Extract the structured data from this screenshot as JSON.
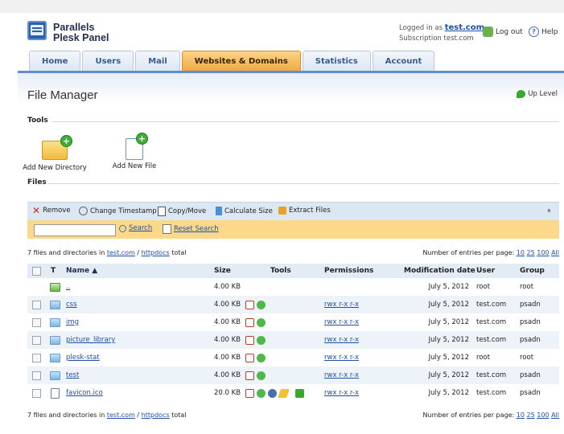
{
  "app": {
    "line1": "Parallels",
    "line2": "Plesk Panel"
  },
  "header": {
    "logged_prefix": "Logged in as",
    "user": "test.com",
    "subscription": "Subscription test.com",
    "logout": "Log out",
    "help": "Help"
  },
  "tabs": [
    "Home",
    "Users",
    "Mail",
    "Websites & Domains",
    "Statistics",
    "Account"
  ],
  "page": {
    "title": "File Manager",
    "up_level": "Up Level"
  },
  "tools": {
    "heading": "Tools",
    "add_directory": "Add New Directory",
    "add_file": "Add New File"
  },
  "files_heading": "Files",
  "toolbar": {
    "remove": "Remove",
    "change_timestamp": "Change Timestamp",
    "copy_move": "Copy/Move",
    "calc_size": "Calculate Size",
    "extract": "Extract Files",
    "collapse": "»"
  },
  "search": {
    "value": "",
    "search": "Search",
    "reset": "Reset Search"
  },
  "summary": {
    "count_text": "7 files and directories in",
    "path1": "test.com",
    "sep": "/",
    "path2": "httpdocs",
    "total": "total",
    "per_page_label": "Number of entries per page:",
    "per_page_options": [
      "10",
      "25",
      "100",
      "All"
    ]
  },
  "columns": {
    "type": "T",
    "name": "Name ▲",
    "size": "Size",
    "tools": "Tools",
    "permissions": "Permissions",
    "modified": "Modification date",
    "user": "User",
    "group": "Group"
  },
  "rows": [
    {
      "icon": "folder-up-icon",
      "name": "..",
      "size": "4.00 KB",
      "perms": "",
      "date": "July 5, 2012",
      "user": "root",
      "group": "root"
    },
    {
      "icon": "folder-icon",
      "name": "css",
      "size": "4.00 KB",
      "perms": "rwx r-x r-x",
      "date": "July 5, 2012",
      "user": "test.com",
      "group": "psadn"
    },
    {
      "icon": "folder-icon",
      "name": "img",
      "size": "4.00 KB",
      "perms": "rwx r-x r-x",
      "date": "July 5, 2012",
      "user": "test.com",
      "group": "psadn"
    },
    {
      "icon": "folder-icon",
      "name": "picture_library",
      "size": "4.00 KB",
      "perms": "rwx r-x r-x",
      "date": "July 5, 2012",
      "user": "test.com",
      "group": "psadn"
    },
    {
      "icon": "folder-icon",
      "name": "plesk-stat",
      "size": "4.00 KB",
      "perms": "rwx r-x r-x",
      "date": "July 5, 2012",
      "user": "root",
      "group": "root"
    },
    {
      "icon": "folder-icon",
      "name": "test",
      "size": "4.00 KB",
      "perms": "rwx r-x r-x",
      "date": "July 5, 2012",
      "user": "test.com",
      "group": "psadn"
    },
    {
      "icon": "file-icon",
      "name": "favicon.ico",
      "size": "20.0 KB",
      "perms": "rwx r-x r-x",
      "date": "July 5, 2012",
      "user": "test.com",
      "group": "psadn"
    }
  ]
}
